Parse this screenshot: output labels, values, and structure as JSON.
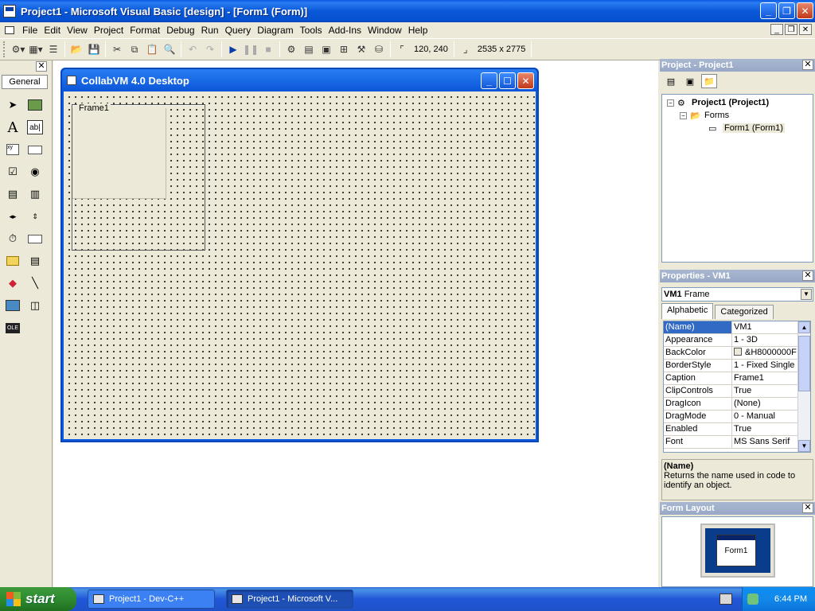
{
  "window": {
    "title": "Project1 - Microsoft Visual Basic [design] - [Form1 (Form)]"
  },
  "menu": [
    "File",
    "Edit",
    "View",
    "Project",
    "Format",
    "Debug",
    "Run",
    "Query",
    "Diagram",
    "Tools",
    "Add-Ins",
    "Window",
    "Help"
  ],
  "toolbar": {
    "position_readout": "120, 240",
    "size_readout": "2535 x 2775"
  },
  "toolbox": {
    "tab_label": "General",
    "tools": [
      "pointer-icon",
      "picturebox-icon",
      "label-icon",
      "textbox-icon",
      "frame-icon",
      "commandbutton-icon",
      "checkbox-icon",
      "optionbutton-icon",
      "combobox-icon",
      "listbox-icon",
      "hscrollbar-icon",
      "vscrollbar-icon",
      "timer-icon",
      "drivelistbox-icon",
      "dirlistbox-icon",
      "filelistbox-icon",
      "shape-icon",
      "line-icon",
      "image-icon",
      "data-icon",
      "ole-icon"
    ]
  },
  "form": {
    "title": "CollabVM 4.0 Desktop",
    "frame_caption": "Frame1"
  },
  "project": {
    "title": "Project - Project1",
    "tree": {
      "root": "Project1 (Project1)",
      "folder": "Forms",
      "item": "Form1 (Form1)"
    }
  },
  "properties": {
    "title": "Properties - VM1",
    "object_name": "VM1",
    "object_type": "Frame",
    "tabs": [
      "Alphabetic",
      "Categorized"
    ],
    "rows": [
      {
        "name": "(Name)",
        "value": "VM1"
      },
      {
        "name": "Appearance",
        "value": "1 - 3D"
      },
      {
        "name": "BackColor",
        "value": "&H8000000F"
      },
      {
        "name": "BorderStyle",
        "value": "1 - Fixed Single"
      },
      {
        "name": "Caption",
        "value": "Frame1"
      },
      {
        "name": "ClipControls",
        "value": "True"
      },
      {
        "name": "DragIcon",
        "value": "(None)"
      },
      {
        "name": "DragMode",
        "value": "0 - Manual"
      },
      {
        "name": "Enabled",
        "value": "True"
      },
      {
        "name": "Font",
        "value": "MS Sans Serif"
      }
    ],
    "desc_name": "(Name)",
    "desc_text": "Returns the name used in code to identify an object."
  },
  "form_layout": {
    "title": "Form Layout",
    "mini_form_label": "Form1"
  },
  "taskbar": {
    "start_label": "start",
    "items": [
      "Project1 - Dev-C++",
      "Project1 - Microsoft V..."
    ],
    "clock": "6:44 PM"
  }
}
